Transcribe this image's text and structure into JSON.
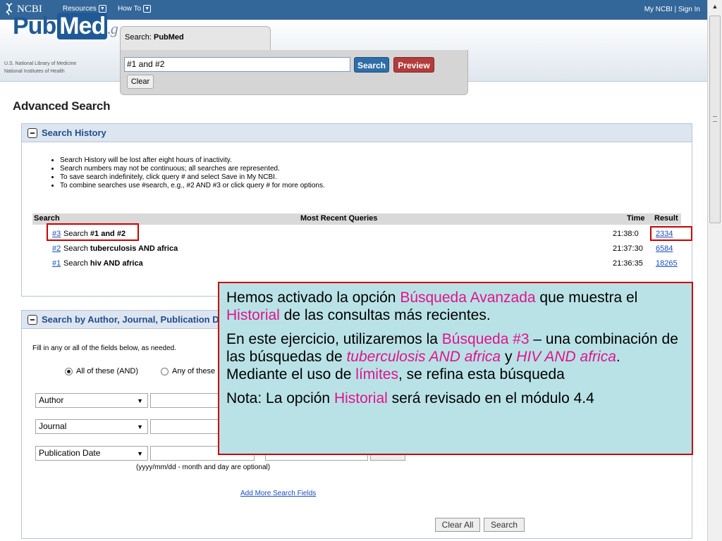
{
  "topbar": {
    "logo": "NCBI",
    "menu_resources": "Resources",
    "menu_howto": "How To",
    "signin": "My NCBI | Sign In"
  },
  "header": {
    "logo_pub": "Pub",
    "logo_med": "Med",
    "logo_suffix": ".g",
    "nlm_line1": "U.S. National Library of Medicine",
    "nlm_line2": "National Institutes of Health",
    "search_label_prefix": "Search:",
    "search_label_db": "PubMed",
    "search_value": "#1 and #2",
    "search_button": "Search",
    "preview_button": "Preview",
    "clear_button": "Clear"
  },
  "page_title": "Advanced Search",
  "history": {
    "title": "Search History",
    "bullets": [
      "Search History will be lost after eight hours of inactivity.",
      "Search numbers may not be continuous; all searches are represented.",
      "To save search indefinitely, click query # and select Save in My NCBI.",
      "To combine searches use #search, e.g., #2 AND #3 or click query # for more options."
    ],
    "columns": {
      "search": "Search",
      "queries": "Most Recent Queries",
      "time": "Time",
      "result": "Result"
    },
    "rows": [
      {
        "num": "#3",
        "prefix": "Search",
        "query": "#1 and #2",
        "time": "21:38:0",
        "result": "2334"
      },
      {
        "num": "#2",
        "prefix": "Search",
        "query": "tuberculosis AND africa",
        "time": "21:37:30",
        "result": "6584"
      },
      {
        "num": "#1",
        "prefix": "Search",
        "query": "hiv AND africa",
        "time": "21:36:35",
        "result": "18265"
      }
    ]
  },
  "author": {
    "title": "Search by Author, Journal, Publication Date",
    "fill_text": "Fill in any or all of the fields below, as needed.",
    "radio_all": "All of these (AND)",
    "radio_any": "Any of these",
    "field_author": "Author",
    "field_journal": "Journal",
    "field_pubdate": "Publication Date",
    "date_hint": "(yyyy/mm/dd - month and day are optional)",
    "add_fields": "Add More Search Fields",
    "clear_all": "Clear All",
    "search_button": "Search"
  },
  "callout": {
    "p1_a": "Hemos activado la opción ",
    "p1_hl1": "Búsqueda Avanzada",
    "p1_b": " que muestra el ",
    "p1_hl2": "Historial",
    "p1_c": " de las consultas más recientes.",
    "p2_a": "En este ejercicio, utilizaremos la ",
    "p2_hl1": "Búsqueda #3",
    "p2_b": " – una combinación de las búsquedas de ",
    "p2_hl2": "tuberculosis AND africa",
    "p2_c": " y ",
    "p2_hl3": "HIV AND africa",
    "p2_d": ". Mediante el uso de ",
    "p2_hl4": "límites",
    "p2_e": ", se refina esta búsqueda",
    "p3_a": "Nota: La opción ",
    "p3_hl": "Historial",
    "p3_b": " será revisado en el módulo 4.4"
  },
  "colors": {
    "ncbi_bar": "#336699",
    "highlight": "#e0138c",
    "callout_bg": "#b9e2e6",
    "annotation_red": "#cc0000"
  }
}
